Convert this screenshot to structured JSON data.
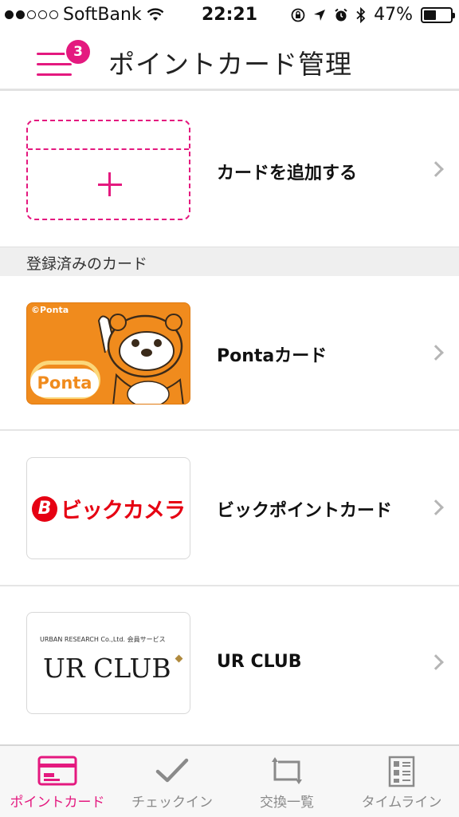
{
  "status_bar": {
    "carrier": "SoftBank",
    "time": "22:21",
    "battery_percent": "47%",
    "battery_level": 0.47,
    "signal_dots_filled": 2,
    "signal_dots_total": 5
  },
  "nav": {
    "title": "ポイントカード管理",
    "badge_count": "3",
    "accent_color": "#e4197f"
  },
  "add_card": {
    "label": "カードを追加する",
    "icon": "plus-icon"
  },
  "section": {
    "header": "登録済みのカード"
  },
  "cards": [
    {
      "name": "Pontaカード",
      "thumb_copyright": "©Ponta",
      "thumb_logo_text": "Ponta"
    },
    {
      "name": "ビックポイントカード",
      "thumb_logo_text": "ビックカメラ",
      "thumb_logo_mark": "B"
    },
    {
      "name": "UR CLUB",
      "thumb_subtitle": "URBAN RESEARCH Co.,Ltd. 会員サービス",
      "thumb_logo_text": "UR CLUB"
    }
  ],
  "tabbar": {
    "tabs": [
      {
        "label": "ポイントカード",
        "icon": "card-icon",
        "active": true
      },
      {
        "label": "チェックイン",
        "icon": "checkmark-icon",
        "active": false
      },
      {
        "label": "交換一覧",
        "icon": "exchange-icon",
        "active": false
      },
      {
        "label": "タイムライン",
        "icon": "timeline-icon",
        "active": false
      }
    ]
  }
}
